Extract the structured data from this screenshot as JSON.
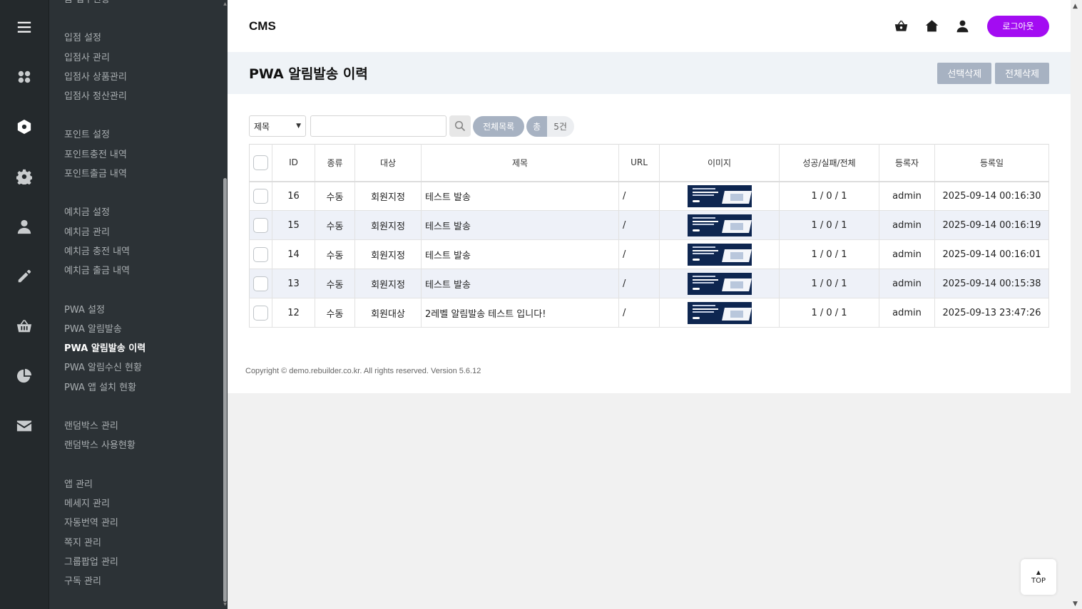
{
  "sidebar": {
    "groups": [
      [
        "폼 접수현황"
      ],
      [
        "입점 설정",
        "입점사 관리",
        "입점사 상품관리",
        "입점사 정산관리"
      ],
      [
        "포인트 설정",
        "포인트충전 내역",
        "포인트출금 내역"
      ],
      [
        "예치금 설정",
        "예치금 관리",
        "예치금 충전 내역",
        "예치금 출금 내역"
      ],
      [
        "PWA 설정",
        "PWA 알림발송",
        "PWA 알림발송 이력",
        "PWA 알림수신 현황",
        "PWA 앱 설치 현황"
      ],
      [
        "랜덤박스 관리",
        "랜덤박스 사용현황"
      ],
      [
        "앱 관리",
        "메세지 관리",
        "자동번역 관리",
        "쪽지 관리",
        "그룹팝업 관리",
        "구독 관리"
      ]
    ],
    "active": "PWA 알림발송 이력",
    "rail_icons": [
      "menu-icon",
      "apps-icon",
      "module-icon",
      "settings-icon",
      "user-icon",
      "edit-icon",
      "basket-icon",
      "pie-chart-icon",
      "mail-icon"
    ]
  },
  "header": {
    "logo": "CMS",
    "icons": [
      "basket-icon",
      "home-icon",
      "user-icon"
    ],
    "logout_label": "로그아웃",
    "logout_color": "#a30cf2"
  },
  "page": {
    "title": "PWA 알림발송 이력",
    "delete_selected_label": "선택삭제",
    "delete_all_label": "전체삭제"
  },
  "search": {
    "field_selected": "제목",
    "query": "",
    "all_list_label": "전체목록",
    "total_label": "총",
    "total_count": "5건"
  },
  "table": {
    "headers": [
      "ID",
      "종류",
      "대상",
      "제목",
      "URL",
      "이미지",
      "성공/실패/전체",
      "등록자",
      "등록일"
    ],
    "rows": [
      {
        "id": "16",
        "type": "수동",
        "target": "회원지정",
        "subject": "테스트 발송",
        "url": "/",
        "result": "1 / 0 / 1",
        "author": "admin",
        "date": "2025-09-14 00:16:30"
      },
      {
        "id": "15",
        "type": "수동",
        "target": "회원지정",
        "subject": "테스트 발송",
        "url": "/",
        "result": "1 / 0 / 1",
        "author": "admin",
        "date": "2025-09-14 00:16:19"
      },
      {
        "id": "14",
        "type": "수동",
        "target": "회원지정",
        "subject": "테스트 발송",
        "url": "/",
        "result": "1 / 0 / 1",
        "author": "admin",
        "date": "2025-09-14 00:16:01"
      },
      {
        "id": "13",
        "type": "수동",
        "target": "회원지정",
        "subject": "테스트 발송",
        "url": "/",
        "result": "1 / 0 / 1",
        "author": "admin",
        "date": "2025-09-14 00:15:38"
      },
      {
        "id": "12",
        "type": "수동",
        "target": "회원대상",
        "subject": "2레벨 알림발송 테스트 입니다!",
        "url": "/",
        "result": "1 / 0 / 1",
        "author": "admin",
        "date": "2025-09-13 23:47:26"
      }
    ]
  },
  "footer": {
    "copyright": "Copyright © demo.rebuilder.co.kr. All rights reserved. Version 5.6.12"
  },
  "top_button_label": "TOP"
}
